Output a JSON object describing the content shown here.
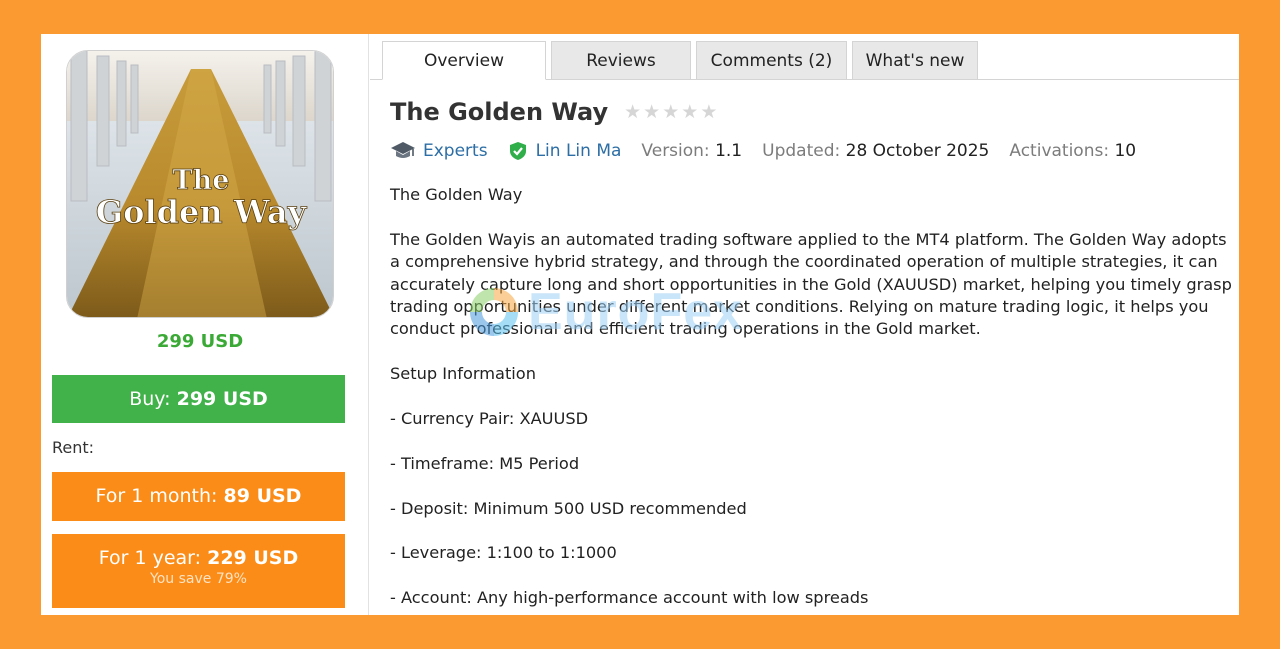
{
  "product": {
    "image_text_line1": "The",
    "image_text_line2": "Golden Way",
    "price": "299 USD"
  },
  "purchase": {
    "buy_prefix": "Buy:",
    "buy_price": "299 USD",
    "rent_label": "Rent:",
    "month_prefix": "For 1 month:",
    "month_price": "89 USD",
    "year_prefix": "For 1 year:",
    "year_price": "229 USD",
    "year_save": "You save 79%"
  },
  "tabs": [
    {
      "label": "Overview",
      "active": true
    },
    {
      "label": "Reviews",
      "active": false
    },
    {
      "label": "Comments (2)",
      "active": false
    },
    {
      "label": "What's new",
      "active": false
    }
  ],
  "header": {
    "title": "The Golden Way",
    "rating_stars": 0,
    "rating_max": 5
  },
  "meta": {
    "category": "Experts",
    "author": "Lin Lin Ma",
    "version_label": "Version:",
    "version_value": "1.1",
    "updated_label": "Updated:",
    "updated_value": "28 October 2025",
    "activations_label": "Activations:",
    "activations_value": "10"
  },
  "description": [
    "The Golden Way",
    "The Golden Wayis an automated trading software applied to the MT4 platform. The Golden Way adopts a comprehensive hybrid strategy, and through the coordinated operation of multiple strategies, it can accurately capture long and short opportunities in the Gold (XAUUSD) market, helping you timely grasp trading opportunities under different market conditions. Relying on mature trading logic, it helps you conduct professional and efficient trading operations in the Gold market.",
    "Setup Information",
    "- Currency Pair: XAUUSD",
    "- Timeframe: M5 Period",
    "- Deposit: Minimum 500 USD recommended",
    "- Leverage: 1:100 to 1:1000",
    "- Account: Any high-performance account with low spreads"
  ],
  "watermark": {
    "text": "EuroFex"
  },
  "colors": {
    "background": "#fc9a32",
    "buy_green": "#41b14a",
    "rent_orange": "#fb8c17",
    "link_blue": "#2c6ea5",
    "price_green": "#3aa935"
  }
}
